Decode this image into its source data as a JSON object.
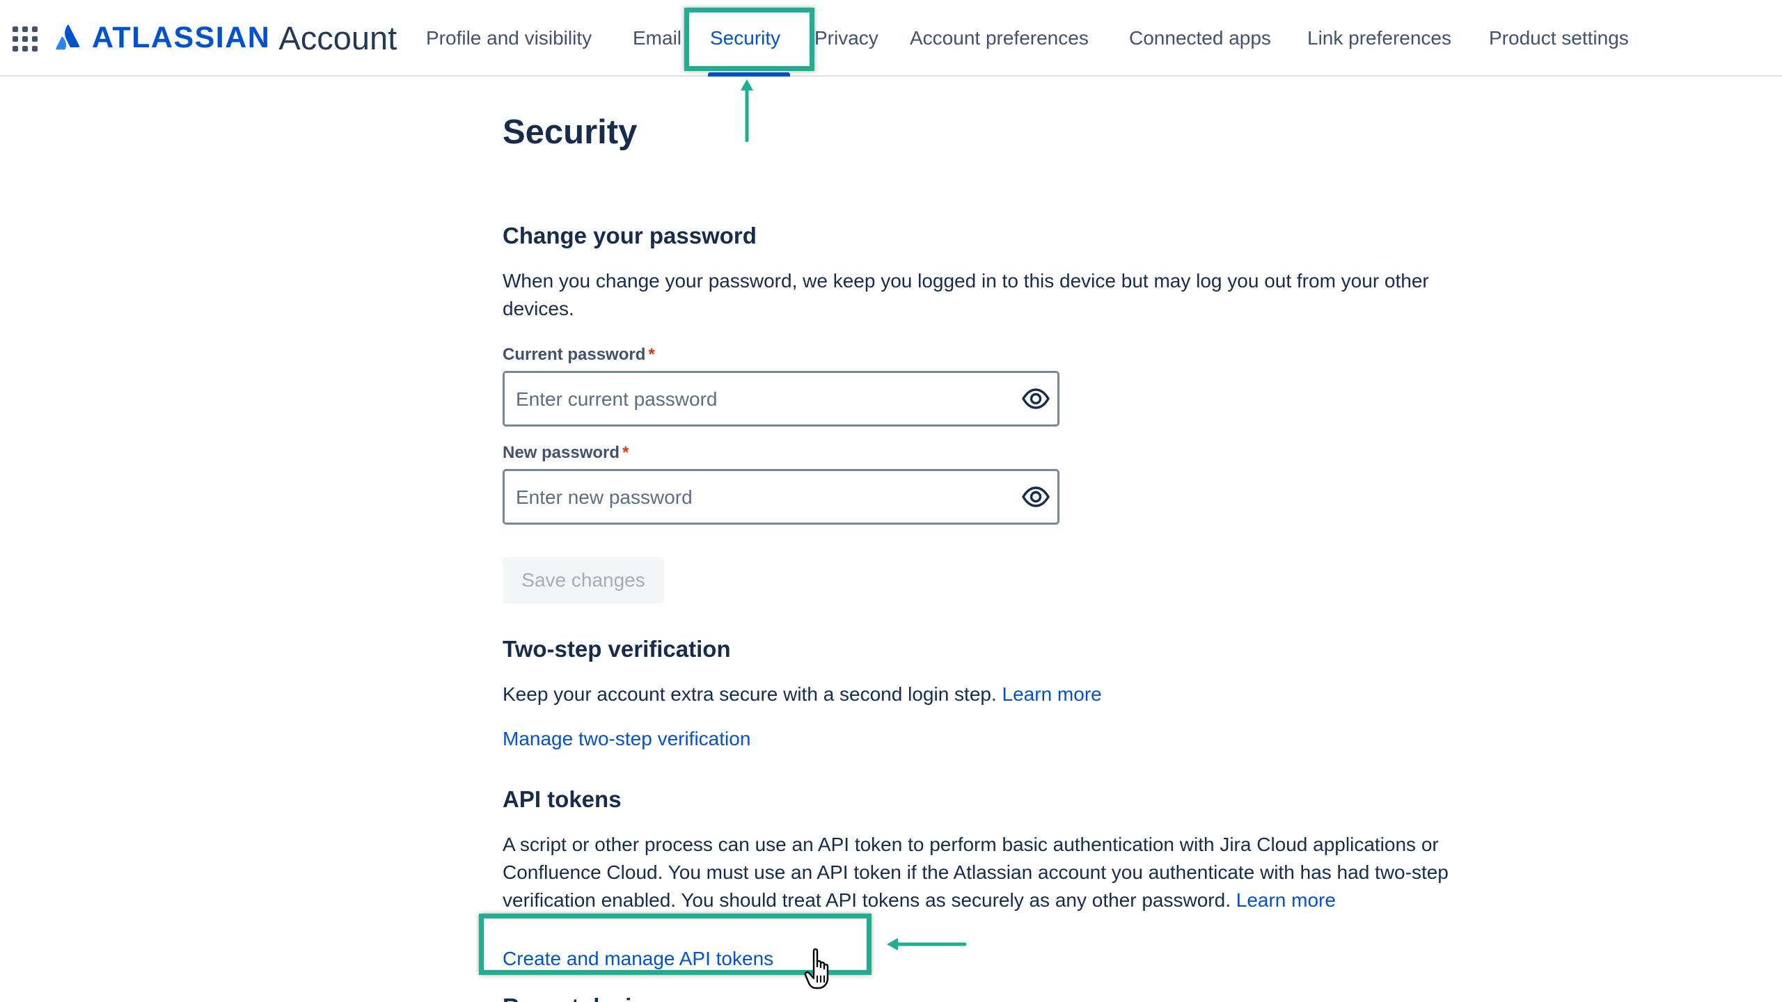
{
  "header": {
    "brand": "ATLASSIAN",
    "product": "Account",
    "nav": [
      {
        "label": "Profile and visibility"
      },
      {
        "label": "Email"
      },
      {
        "label": "Security",
        "active": true
      },
      {
        "label": "Privacy"
      },
      {
        "label": "Account preferences"
      },
      {
        "label": "Connected apps"
      },
      {
        "label": "Link preferences"
      },
      {
        "label": "Product settings"
      }
    ],
    "icons": {
      "app_switcher": "app-switcher-icon",
      "logo": "atlassian-logo-icon"
    }
  },
  "page": {
    "title": "Security"
  },
  "password": {
    "title": "Change your password",
    "description": "When you change your password, we keep you logged in to this device but may log you out from your other devices.",
    "current_label": "Current password",
    "current_placeholder": "Enter current password",
    "new_label": "New password",
    "new_placeholder": "Enter new password",
    "required_mark": "*",
    "save_label": "Save changes"
  },
  "two_step": {
    "title": "Two-step verification",
    "description": "Keep your account extra secure with a second login step.",
    "learn_more": "Learn more",
    "manage_link": "Manage two-step verification"
  },
  "api_tokens": {
    "title": "API tokens",
    "description": "A script or other process can use an API token to perform basic authentication with Jira Cloud applications or Confluence Cloud. You must use an API token if the Atlassian account you authenticate with has had two-step verification enabled. You should treat API tokens as securely as any other password.",
    "learn_more": "Learn more",
    "manage_link": "Create and manage API tokens"
  },
  "next_section": {
    "title": "Recent devices"
  },
  "colors": {
    "accent": "#0052cc",
    "annotation": "#1fae92",
    "text": "#172b4d",
    "nav_text": "#42526e",
    "required": "#de350b"
  }
}
